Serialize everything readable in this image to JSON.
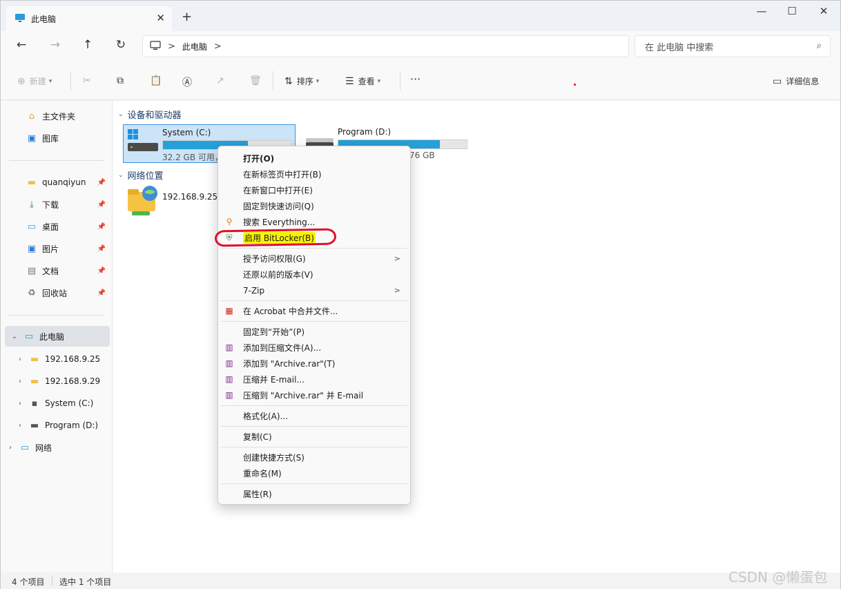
{
  "window": {
    "tab_title": "此电脑",
    "new_tab": "+",
    "controls": {
      "minimize": "—",
      "maximize": "☐",
      "close": "✕"
    }
  },
  "nav": {
    "back": "←",
    "forward": "→",
    "up": "↑",
    "refresh": "↻",
    "breadcrumb": [
      "此电脑"
    ],
    "breadcrumb_sep": ">",
    "search_placeholder": "在 此电脑 中搜索"
  },
  "toolbar": {
    "new_label": "新建",
    "sort_label": "排序",
    "view_label": "查看",
    "more": "···",
    "details_label": "详细信息"
  },
  "sidebar": {
    "home": "主文件夹",
    "gallery": "图库",
    "pinned": [
      {
        "label": "quanqiyun"
      },
      {
        "label": "下载"
      },
      {
        "label": "桌面"
      },
      {
        "label": "图片"
      },
      {
        "label": "文档"
      },
      {
        "label": "回收站"
      }
    ],
    "this_pc": "此电脑",
    "tree": [
      {
        "label": "192.168.9.25"
      },
      {
        "label": "192.168.9.29"
      },
      {
        "label": "System (C:)"
      },
      {
        "label": "Program (D:)"
      }
    ],
    "network": "网络"
  },
  "content": {
    "devices_group": "设备和驱动器",
    "network_group": "网络位置",
    "drives": [
      {
        "name": "System (C:)",
        "info": "32.2 GB 可用，",
        "used_fraction": 0.66
      },
      {
        "name": "Program (D:)",
        "info": "76 GB",
        "used_fraction": 0.79
      }
    ],
    "network_location": "192.168.9.25"
  },
  "context_menu": {
    "items": [
      {
        "label": "打开(O)",
        "bold": true
      },
      {
        "label": "在新标签页中打开(B)"
      },
      {
        "label": "在新窗口中打开(E)"
      },
      {
        "label": "固定到快速访问(Q)"
      },
      {
        "label": "搜索 Everything..."
      },
      {
        "label": "启用 BitLocker(B)",
        "highlight": true
      },
      {
        "label": "授予访问权限(G)",
        "submenu": true
      },
      {
        "label": "还原以前的版本(V)"
      },
      {
        "label": "7-Zip",
        "submenu": true
      },
      {
        "label": "在 Acrobat 中合并文件..."
      },
      {
        "label": "固定到“开始”(P)"
      },
      {
        "label": "添加到压缩文件(A)..."
      },
      {
        "label": "添加到 \"Archive.rar\"(T)"
      },
      {
        "label": "压缩并 E-mail..."
      },
      {
        "label": "压缩到 \"Archive.rar\" 并 E-mail"
      },
      {
        "label": "格式化(A)..."
      },
      {
        "label": "复制(C)"
      },
      {
        "label": "创建快捷方式(S)"
      },
      {
        "label": "重命名(M)"
      },
      {
        "label": "属性(R)"
      }
    ],
    "submenu_arrow": ">"
  },
  "status": {
    "item_count": "4 个项目",
    "selected": "选中 1 个项目"
  },
  "watermark": "CSDN @懒蛋包",
  "colors": {
    "accent": "#26a0da",
    "selection": "#cce4f7",
    "annotation": "#e0102a",
    "highlight": "#f8f400"
  }
}
